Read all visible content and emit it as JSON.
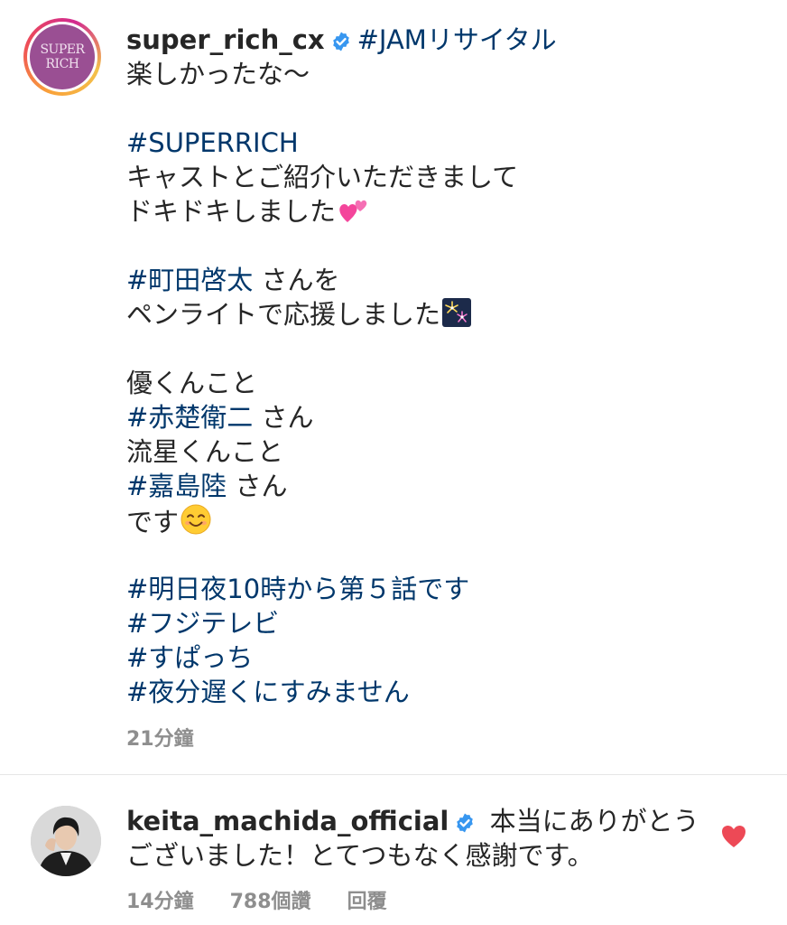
{
  "post": {
    "avatar_text_line1": "SUPER",
    "avatar_text_line2": "RICH",
    "username": "super_rich_cx",
    "header_tag": "#JAMリサイタル",
    "caption": {
      "line_1": "楽しかったな〜",
      "line_3": "#SUPERRICH",
      "line_4": "キャストとご紹介いただきまして",
      "line_5": "ドキドキしました",
      "line_7_tag": "#町田啓太",
      "line_7_text": " さんを",
      "line_8": "ペンライトで応援しました",
      "line_10": "優くんこと",
      "line_11_tag": "#赤楚衛二",
      "line_11_text": " さん",
      "line_12": "流星くんこと",
      "line_13_tag": "#嘉島陸",
      "line_13_text": " さん",
      "line_14": "です",
      "line_16": "#明日夜10時から第５話です",
      "line_17": "#フジテレビ",
      "line_18": "#すぱっち",
      "line_19": "#夜分遅くにすみません"
    },
    "time_ago": "21分鐘"
  },
  "comment": {
    "username": "keita_machida_official",
    "text_line_1": " 本当にありがとう",
    "text_line_2": "ございました！とてつもなく感謝です。",
    "time_ago": "14分鐘",
    "likes": "788個讚",
    "reply_label": "回覆",
    "liked": true
  },
  "colors": {
    "hashtag": "#00376b",
    "verified_badge": "#3897f0",
    "heart": "#ed4956",
    "meta_text": "#8e8e8e",
    "avatar_bg": "#9a4f93"
  },
  "icons": [
    "verified-badge-icon",
    "two-hearts-emoji",
    "fireworks-emoji",
    "smiling-face-emoji",
    "heart-icon"
  ]
}
